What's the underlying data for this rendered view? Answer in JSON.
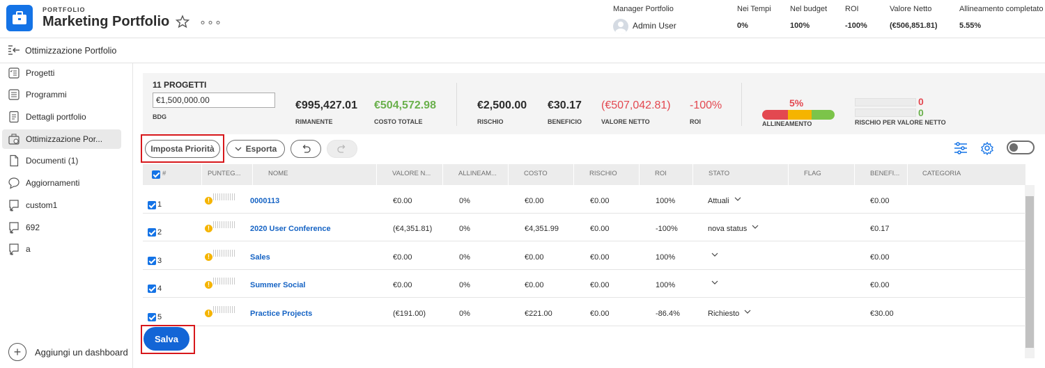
{
  "header": {
    "kicker": "PORTFOLIO",
    "title": "Marketing Portfolio",
    "more": "∘∘∘",
    "manager_label": "Manager Portfolio",
    "manager_name": "Admin User",
    "stats": [
      {
        "label": "Nei Tempi",
        "value": "0%"
      },
      {
        "label": "Nel budget",
        "value": "100%"
      },
      {
        "label": "ROI",
        "value": "-100%"
      },
      {
        "label": "Valore Netto",
        "value": "(€506,851.81)"
      },
      {
        "label": "Allineamento completato",
        "value": "5.55%"
      }
    ]
  },
  "subheader": {
    "title": "Ottimizzazione Portfolio"
  },
  "sidebar": {
    "items": [
      {
        "label": "Progetti",
        "icon": "projects-icon"
      },
      {
        "label": "Programmi",
        "icon": "programs-icon"
      },
      {
        "label": "Dettagli portfolio",
        "icon": "details-icon"
      },
      {
        "label": "Ottimizzazione Por...",
        "icon": "optimizer-icon",
        "active": true
      },
      {
        "label": "Documenti (1)",
        "icon": "document-icon"
      },
      {
        "label": "Aggiornamenti",
        "icon": "chat-icon"
      },
      {
        "label": "custom1",
        "icon": "custom-icon"
      },
      {
        "label": "692",
        "icon": "custom-icon"
      },
      {
        "label": "a",
        "icon": "custom-icon"
      }
    ],
    "add_dashboard": "Aggiungi un dashboard"
  },
  "summary": {
    "count": "11 PROGETTI",
    "budget_value": "€1,500,000.00",
    "budget_label": "BDG",
    "metrics": [
      {
        "value": "€995,427.01",
        "label": "RIMANENTE",
        "color": "#2c2c2c"
      },
      {
        "value": "€504,572.98",
        "label": "COSTO TOTALE",
        "color": "#6ab04c"
      },
      {
        "value": "€2,500.00",
        "label": "RISCHIO",
        "color": "#2c2c2c"
      },
      {
        "value": "€30.17",
        "label": "BENEFICIO",
        "color": "#2c2c2c"
      },
      {
        "value": "(€507,042.81)",
        "label": "VALORE NETTO",
        "color": "#e34850"
      },
      {
        "value": "-100%",
        "label": "ROI",
        "color": "#e34850"
      }
    ],
    "alignment_pct": "5%",
    "alignment_label": "ALLINEAMENTO",
    "risk_value_top": "0",
    "risk_value_bottom": "0",
    "risk_label": "RISCHIO PER VALORE NETTO"
  },
  "toolbar": {
    "set_priority": "Imposta Priorità",
    "export": "Esporta"
  },
  "table": {
    "columns": [
      "#",
      "PUNTEG...",
      "NOME",
      "VALORE N...",
      "ALLINEAM...",
      "COSTO",
      "RISCHIO",
      "ROI",
      "STATO",
      "FLAG",
      "BENEFI...",
      "CATEGORIA"
    ],
    "rows": [
      {
        "num": "1",
        "name": "0000113",
        "net": "€0.00",
        "align": "0%",
        "cost": "€0.00",
        "risk": "€0.00",
        "roi": "100%",
        "status": "Attuali",
        "benefit": "€0.00"
      },
      {
        "num": "2",
        "name": "2020 User Conference",
        "net": "(€4,351.81)",
        "align": "0%",
        "cost": "€4,351.99",
        "risk": "€0.00",
        "roi": "-100%",
        "status": "nova status",
        "benefit": "€0.17"
      },
      {
        "num": "3",
        "name": "Sales",
        "net": "€0.00",
        "align": "0%",
        "cost": "€0.00",
        "risk": "€0.00",
        "roi": "100%",
        "status": "",
        "benefit": "€0.00"
      },
      {
        "num": "4",
        "name": "Summer Social",
        "net": "€0.00",
        "align": "0%",
        "cost": "€0.00",
        "risk": "€0.00",
        "roi": "100%",
        "status": "",
        "benefit": "€0.00"
      },
      {
        "num": "5",
        "name": "Practice Projects",
        "net": "(€191.00)",
        "align": "0%",
        "cost": "€221.00",
        "risk": "€0.00",
        "roi": "-86.4%",
        "status": "Richiesto",
        "benefit": "€30.00"
      }
    ]
  },
  "save_label": "Salva"
}
